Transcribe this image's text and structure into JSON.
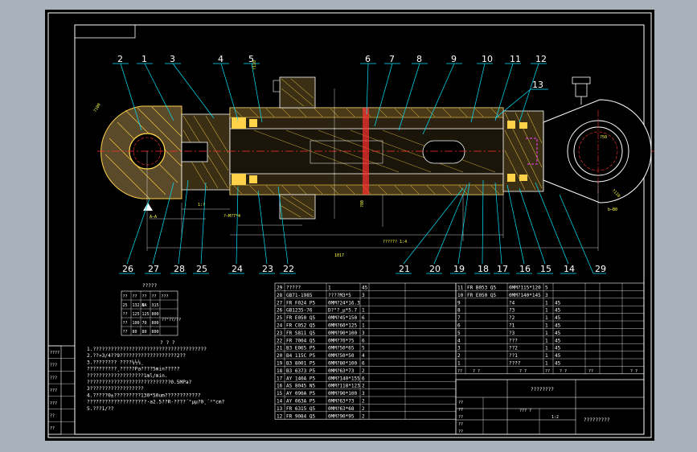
{
  "drawing": {
    "callouts_top": [
      "2",
      "1",
      "3",
      "4",
      "5",
      "6",
      "7",
      "8",
      "9",
      "10",
      "11",
      "12"
    ],
    "callout_13": "13",
    "callouts_bottom": [
      "26",
      "27",
      "28",
      "25",
      "24",
      "23",
      "22",
      "21",
      "20",
      "19",
      "18",
      "17",
      "16",
      "15",
      "14"
    ],
    "callout_29": "29"
  },
  "small_table": {
    "title": "?????",
    "rows": [
      [
        "??",
        "??",
        "??",
        "??",
        "???"
      ],
      [
        "25",
        "132.6",
        "NA",
        "315",
        ""
      ],
      [
        "??",
        "125",
        "125",
        "800",
        ""
      ],
      [
        "??",
        "100",
        "70",
        "800",
        ""
      ],
      [
        "??",
        "80",
        "80",
        "800",
        ""
      ]
    ],
    "note": "??²??/??"
  },
  "notes": {
    "title": "?  ?  ?",
    "lines": [
      "1.??????????????????????????????????????",
      "2.??»3/4??9???????????????????2??",
      "3.????????    ????¼½¼¸",
      "  ??????????¸?????Pa????5min?????",
      "  ???????????????????1ml/min.",
      "  ????????????????????????????0.5MPa?",
      "  3??????????????????",
      "4.?????0±?????????130*50um????????????",
      "  ????????????????????·a2.5??R·????´°µµ?0¸´³°cm?",
      "5.???1/??"
    ]
  },
  "bom_left": {
    "rows": [
      [
        "29",
        "?????",
        "1",
        "45"
      ],
      [
        "28",
        "GB71-1985",
        "????M3*5",
        "3",
        ""
      ],
      [
        "27",
        "FR F024 P5",
        "0MM?24*16.3",
        ""
      ],
      [
        "26",
        "GB1235-76",
        "D?°?¸µ*5.7",
        "1",
        ""
      ],
      [
        "25",
        "FR E050 Q5",
        "0MM?45*150",
        "6",
        ""
      ],
      [
        "24",
        "FR C052 Q5",
        "0MM?60*125",
        "1",
        ""
      ],
      [
        "23",
        "FR S811 Q5",
        "0MM?90*100",
        "3",
        ""
      ],
      [
        "22",
        "FR 7004 Q5",
        "0MM?70*75",
        "6",
        ""
      ],
      [
        "21",
        "B3 E065 P5",
        "0MM?50*65",
        "5",
        ""
      ],
      [
        "20",
        "B4 115C P5",
        "0MM?50*50",
        "4",
        ""
      ],
      [
        "19",
        "B3 8001 P5",
        "0MM?80*100",
        "6",
        ""
      ],
      [
        "18",
        "B3 6373 P5",
        "0MM?63*73",
        "2",
        ""
      ],
      [
        "17",
        "AY 140A P5",
        "0MM?140*155",
        "6",
        ""
      ],
      [
        "16",
        "AS 8045 N5",
        "0MM?118*123",
        "2",
        ""
      ],
      [
        "15",
        "AY 090A P5",
        "0MM?90*100",
        "3",
        ""
      ],
      [
        "14",
        "AY 063A P5",
        "0MM?63*73",
        "2",
        ""
      ],
      [
        "13",
        "FR 6315 Q5",
        "0MM?63*68",
        "2",
        ""
      ],
      [
        "12",
        "FR 9084 Q5",
        "0MM?90*95",
        "2",
        ""
      ]
    ]
  },
  "bom_right": {
    "rows": [
      [
        "11",
        "FR B053 Q5",
        "0MM?115*120",
        "5",
        ""
      ],
      [
        "10",
        "FR E050 Q5",
        "0MM?140*145",
        "3",
        ""
      ],
      [
        "9",
        "",
        "?4",
        "1",
        "45"
      ],
      [
        "8",
        "",
        "?3",
        "1",
        "45"
      ],
      [
        "7",
        "",
        "?2",
        "1",
        "45"
      ],
      [
        "6",
        "",
        "?1",
        "1",
        "45"
      ],
      [
        "5",
        "",
        "?3",
        "1",
        "45"
      ],
      [
        "4",
        "",
        "???",
        "1",
        "45"
      ],
      [
        "3",
        "",
        "??2",
        "1",
        "45"
      ],
      [
        "2",
        "",
        "??1",
        "1",
        "45"
      ],
      [
        "1",
        "",
        "????",
        "1",
        "45"
      ]
    ],
    "header": [
      "??",
      "?  ?",
      "?   ?",
      "??",
      "?  ?",
      "??",
      "?  ?"
    ]
  },
  "title_block": {
    "drawing_name": "????????",
    "fields": [
      "??",
      "??",
      "??",
      "??",
      "??"
    ],
    "scale": "1:2",
    "company": "?????????",
    "mid_label": "??? ?"
  },
  "revision_block": [
    "????",
    "???",
    "???",
    "???",
    "???",
    "??",
    "??"
  ],
  "dims": {
    "d1": "?100",
    "d2": "1017",
    "d3": "?????? 1:4",
    "d4": "?110",
    "d5": "?50",
    "d6": "?110",
    "d7": "A–A",
    "d8": "b–B0",
    "d9": "?–M?7*4",
    "d10": "1:?",
    "d11": "?80"
  }
}
